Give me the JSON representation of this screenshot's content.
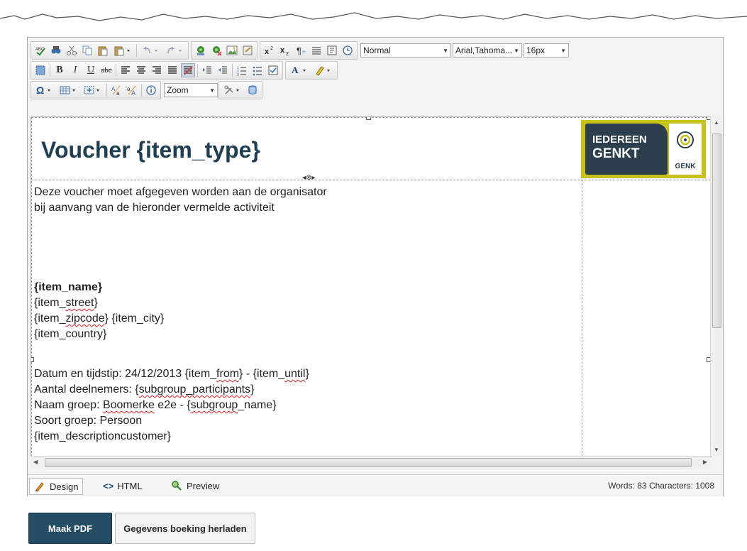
{
  "toolbar": {
    "format_value": "Normal",
    "font_value": "Arial,Tahoma...",
    "size_value": "16px",
    "zoom_value": "Zoom"
  },
  "document": {
    "title": "Voucher {item_type}",
    "intro_line1": "Deze voucher moet afgegeven worden aan de organisator",
    "intro_line2": "bij aanvang van de hieronder vermelde activiteit",
    "item_name": "{item_name}",
    "street_prefix": "{item_",
    "street_word": "street",
    "street_suffix": "}",
    "zip_prefix": "{item_",
    "zip_word": "zipcode",
    "zip_suffix": "} {item_city}",
    "country": "{item_country}",
    "datum_text": "Datum en tijdstip: 24/12/2013 {item_",
    "datum_from": "from",
    "datum_middle": "} - {item_",
    "datum_until": "until",
    "datum_end": "}",
    "aantal_text": "Aantal deelnemers: {",
    "aantal_word": "subgroup_participants",
    "aantal_end": "}",
    "naam_text": "Naam groep: ",
    "naam_word": "Boomerke",
    "naam_middle": " e2e - {",
    "naam_word2": "subgroup",
    "naam_end": "_name}",
    "soort": "Soort groep: Persoon",
    "description": "{item_descriptioncustomer}"
  },
  "logo": {
    "line1": "IEDEREEN",
    "line2": "GENKT",
    "badge": "GENK"
  },
  "status": {
    "design_label": "Design",
    "html_label": "HTML",
    "preview_label": "Preview",
    "counts": "Words: 83  Characters: 1008"
  },
  "actions": {
    "pdf_label": "Maak PDF",
    "reload_label": "Gegevens boeking herladen"
  },
  "colors": {
    "title": "#1f3e52",
    "primary_button": "#254d66",
    "logo_green": "#c7c21a",
    "logo_plate": "#2c3f4d"
  }
}
